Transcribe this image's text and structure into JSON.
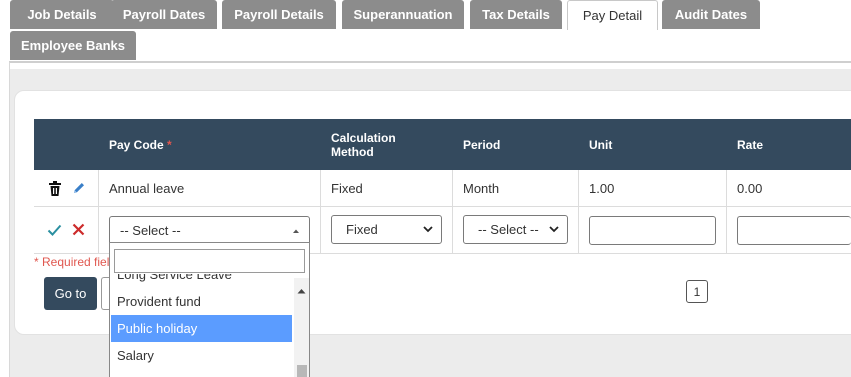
{
  "tabs": [
    {
      "label": "Job Details",
      "active": false
    },
    {
      "label": "Payroll Dates",
      "active": false
    },
    {
      "label": "Payroll Details",
      "active": false
    },
    {
      "label": "Superannuation",
      "active": false
    },
    {
      "label": "Tax Details",
      "active": false
    },
    {
      "label": "Pay Detail",
      "active": true
    },
    {
      "label": "Audit Dates",
      "active": false
    },
    {
      "label": "Employee Banks",
      "active": false
    }
  ],
  "table": {
    "headers": {
      "pay_code": "Pay Code",
      "pay_code_required_mark": "*",
      "calculation_method_line1": "Calculation",
      "calculation_method_line2": "Method",
      "period": "Period",
      "unit": "Unit",
      "rate": "Rate"
    },
    "rows": [
      {
        "pay_code": "Annual leave",
        "calculation_method": "Fixed",
        "period": "Month",
        "unit": "1.00",
        "rate": "0.00"
      }
    ],
    "edit_row": {
      "pay_code_select": "-- Select --",
      "calculation_method_select": "Fixed",
      "period_select": "-- Select --",
      "unit_value": "",
      "rate_value": ""
    }
  },
  "required_note": "* Required fiel",
  "dropdown": {
    "search_value": "",
    "partial_item": "Long Service Leave",
    "items": [
      {
        "label": "Provident fund",
        "highlighted": false
      },
      {
        "label": "Public holiday",
        "highlighted": true
      },
      {
        "label": "Salary",
        "highlighted": false
      }
    ]
  },
  "buttons": {
    "go_to": "Go to"
  },
  "pagination": {
    "current_page": "1"
  },
  "colors": {
    "header_bg": "#344a5e",
    "tab_bg": "#8c8c8c",
    "highlight": "#5b9cff",
    "delete_icon": "#cc2b2b",
    "confirm_icon": "#2a8fa0"
  }
}
